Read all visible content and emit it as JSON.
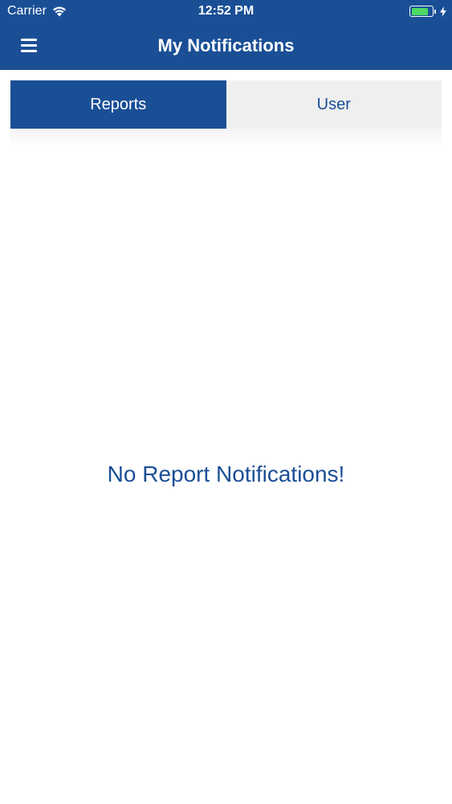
{
  "status_bar": {
    "carrier": "Carrier",
    "time": "12:52 PM",
    "battery_level": 0.8,
    "wifi_icon": "wifi-icon",
    "battery_icon": "battery-icon",
    "charging_icon": "charging-bolt-icon"
  },
  "nav": {
    "title": "My Notifications",
    "menu_icon": "hamburger-menu-icon"
  },
  "tabs": [
    {
      "label": "Reports",
      "active": true
    },
    {
      "label": "User",
      "active": false
    }
  ],
  "empty_state": {
    "message": "No Report Notifications!"
  },
  "colors": {
    "brand": "#1a4f96",
    "tab_inactive_bg": "#efeff0",
    "battery_green": "#4cd964",
    "background": "#ffffff"
  }
}
